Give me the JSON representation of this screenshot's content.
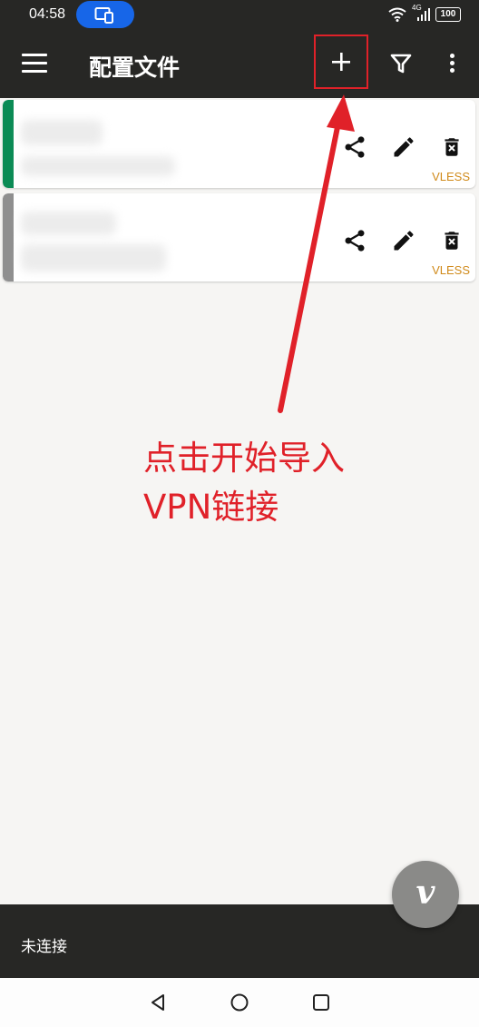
{
  "status_bar": {
    "time": "04:58",
    "network": "4G",
    "battery": "100",
    "icons": [
      "screen-cast-icon",
      "wifi-icon",
      "signal-icon",
      "battery-icon"
    ]
  },
  "app_bar": {
    "title": "配置文件",
    "actions": [
      "menu-icon",
      "add-icon",
      "filter-icon",
      "more-vert-icon"
    ],
    "highlight_color": "#e02129"
  },
  "profiles": [
    {
      "name": "",
      "address": "",
      "protocol": "VLESS",
      "active": true,
      "stripe_color": "#0b8b55"
    },
    {
      "name": "",
      "address": "",
      "protocol": "VLESS",
      "active": false,
      "stripe_color": "#8f8f8f"
    }
  ],
  "card_actions": [
    "share-icon",
    "edit-icon",
    "delete-icon"
  ],
  "annotation": {
    "line1": "点击开始导入",
    "line2": "VPN链接",
    "color": "#e02129"
  },
  "footer": {
    "connection_status": "未连接",
    "fab_icon": "v-connect-icon",
    "fab_glyph": "v"
  },
  "system_nav": [
    "back-icon",
    "home-icon",
    "recents-icon"
  ]
}
